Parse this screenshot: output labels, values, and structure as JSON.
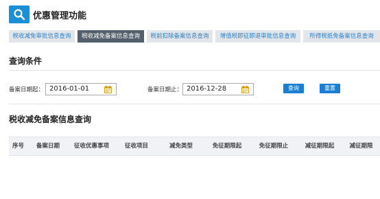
{
  "app": {
    "title": "优惠管理功能",
    "logo_icon": "search-icon"
  },
  "tabs": [
    {
      "label": "税收减免审批信息查询",
      "active": false
    },
    {
      "label": "税收减免备案信息查询",
      "active": true
    },
    {
      "label": "税前扣除备案信息查询",
      "active": false
    },
    {
      "label": "增值税即征即退审批信息查询",
      "active": false
    },
    {
      "label": "所得税抵免备案信息查询",
      "active": false
    }
  ],
  "query": {
    "title": "查询条件",
    "start_label": "备案日期起：",
    "start_value": "2016-01-01",
    "end_label": "备案日期止：",
    "end_value": "2016-12-28",
    "search_button": "查询",
    "reset_button": "重置"
  },
  "results": {
    "title": "税收减免备案信息查询",
    "columns": [
      "序号",
      "备案日期",
      "征收优惠事项",
      "征收项目",
      "减免类型",
      "免征期限起",
      "免征期限止",
      "减征期限起",
      "减征期限"
    ]
  },
  "colors": {
    "accent": "#1a7fd2",
    "active_tab": "#53606b",
    "tab_bg": "#e2e6ea"
  }
}
